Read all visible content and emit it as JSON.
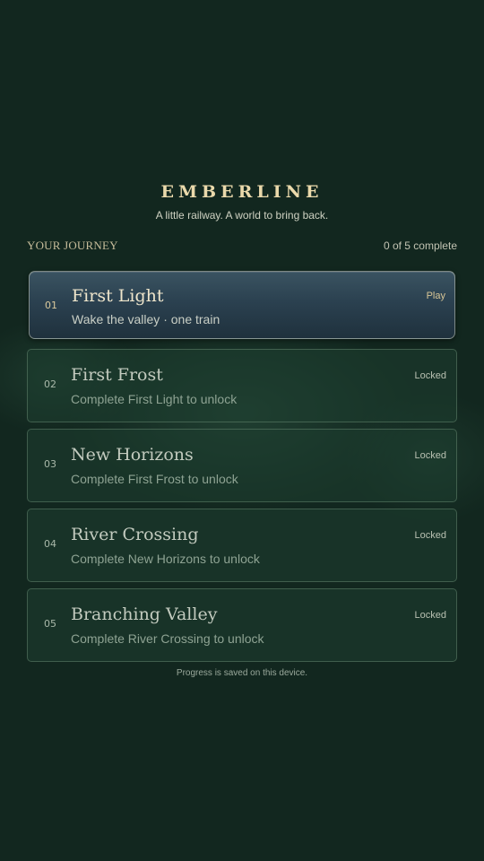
{
  "game": {
    "title": "EMBERLINE",
    "tagline": "A little railway. A world to bring back."
  },
  "journey": {
    "label": "YOUR JOURNEY",
    "progress_text": "0 of 5 complete"
  },
  "levels": [
    {
      "number": "01",
      "name": "First Light",
      "description": "Wake the valley · one train",
      "status": "Play"
    },
    {
      "number": "02",
      "name": "First Frost",
      "description": "Complete First Light to unlock",
      "status": "Locked"
    },
    {
      "number": "03",
      "name": "New Horizons",
      "description": "Complete First Frost to unlock",
      "status": "Locked"
    },
    {
      "number": "04",
      "name": "River Crossing",
      "description": "Complete New Horizons to unlock",
      "status": "Locked"
    },
    {
      "number": "05",
      "name": "Branching Valley",
      "description": "Complete River Crossing to unlock",
      "status": "Locked"
    }
  ],
  "footer": {
    "note": "Progress is saved on this device."
  },
  "colors": {
    "background": "#12271f",
    "title_gold": "#ead9ab",
    "active_card": "#2b4150",
    "locked_card": "#1e3e30"
  }
}
